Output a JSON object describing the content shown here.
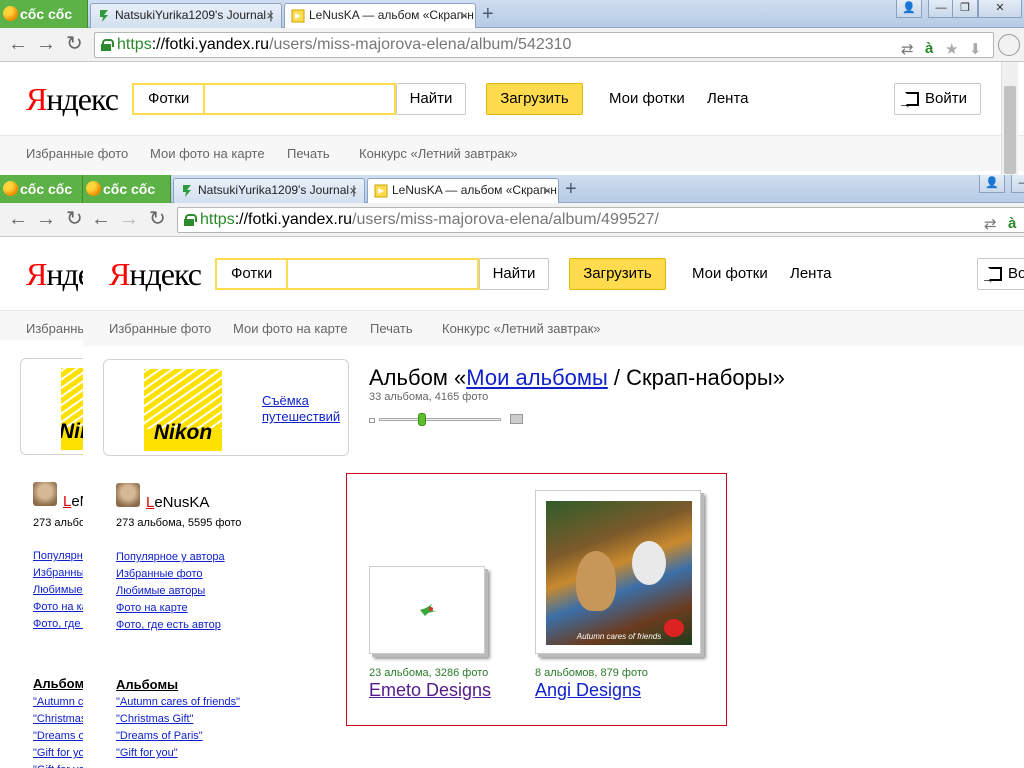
{
  "browser": {
    "coccoc_label": "cốc cốc",
    "tabs_back": [
      {
        "title": "NatsukiYurika1209's Journal |",
        "close": "×"
      },
      {
        "title": "LeNusKA — альбом «Скрап-н",
        "close": "×"
      }
    ],
    "tabs_front": [
      {
        "title": "NatsukiYurika1209's Journal |",
        "close": "×"
      },
      {
        "title": "LeNusKA — альбом «Скрап-н",
        "close": "×"
      }
    ],
    "new_tab": "+",
    "window_controls": [
      "👤",
      "—",
      "❐",
      "✕"
    ],
    "back_url": {
      "scheme": "https",
      "host": "://fotki.yandex.ru",
      "path": "/users/miss-majorova-elena/album/542310"
    },
    "front_url": {
      "scheme": "https",
      "host": "://fotki.yandex.ru",
      "path": "/users/miss-majorova-elena/album/499527/"
    }
  },
  "nav": {
    "back": "←",
    "forward": "→",
    "reload": "↻"
  },
  "header": {
    "logo_first": "Я",
    "logo_rest": "ндекс",
    "service_label": "Фотки",
    "search_value": "",
    "find_button": "Найти",
    "upload_button": "Загрузить",
    "my_photos": "Мои фотки",
    "feed": "Лента",
    "login_button": "Войти"
  },
  "subnav": [
    "Избранные фото",
    "Мои фото на карте",
    "Печать",
    "Конкурс «Летний завтрак»"
  ],
  "sidebar": {
    "logo_word": "Nikon",
    "logo_link_line1": "Съёмка",
    "logo_link_line2": "путешествий",
    "username_first": "L",
    "username_rest": "eNusKA",
    "user_stats": "273 альбома, 5595 фото",
    "links": [
      "Популярное у автора",
      "Избранные фото",
      "Любимые авторы",
      "Фото на карте",
      "Фото, где есть автор"
    ],
    "albums_heading": "Альбомы",
    "albums": [
      "\"Autumn cares of friends\"",
      "\"Christmas Gift\"",
      "\"Dreams of Paris\"",
      "\"Gift for you\""
    ]
  },
  "main": {
    "title_prefix": "Альбом «",
    "title_link": "Мои альбомы",
    "title_sep": " / ",
    "title_current": "Скрап-наборы",
    "title_suffix": "»",
    "stats": "33 альбома, 4165 фото",
    "zoom_level": 0.35,
    "albums": [
      {
        "count": "23 альбома, 3286 фото",
        "name": "Emeto Designs",
        "color": "#551a8b"
      },
      {
        "count": "8 альбомов, 879 фото",
        "name": "Angi Designs",
        "color": "#12c"
      }
    ],
    "angi_cover_caption": "Autumn cares of friends"
  },
  "colors": {
    "yandex_yellow": "#ffdb4d",
    "link": "#12c",
    "frame_red": "#d0021b",
    "coccoc_green": "#5cb246"
  }
}
